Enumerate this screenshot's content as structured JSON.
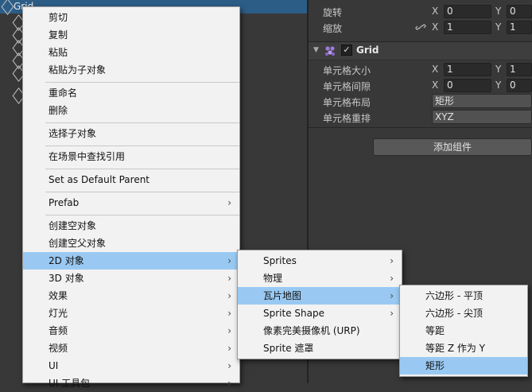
{
  "hierarchy": {
    "selected_item": "Grid"
  },
  "inspector": {
    "transform": {
      "rotation": {
        "label": "旋转",
        "x_axis": "X",
        "x": "0",
        "y_axis": "Y",
        "y": "0"
      },
      "scale": {
        "label": "缩放",
        "x_axis": "X",
        "x": "1",
        "y_axis": "Y",
        "y": "1"
      }
    },
    "grid_component": {
      "title": "Grid",
      "enabled_check": "✓",
      "cell_size": {
        "label": "单元格大小",
        "x_axis": "X",
        "x": "1",
        "y_axis": "Y",
        "y": "1"
      },
      "cell_gap": {
        "label": "单元格间隙",
        "x_axis": "X",
        "x": "0",
        "y_axis": "Y",
        "y": "0"
      },
      "cell_layout": {
        "label": "单元格布局",
        "value": "矩形"
      },
      "cell_swizzle": {
        "label": "单元格重排",
        "value": "XYZ"
      }
    },
    "add_component_label": "添加组件"
  },
  "context_menu": {
    "items": [
      {
        "label": "剪切"
      },
      {
        "label": "复制"
      },
      {
        "label": "粘贴"
      },
      {
        "label": "粘贴为子对象"
      },
      {
        "label": "重命名"
      },
      {
        "label": "删除"
      },
      {
        "label": "选择子对象"
      },
      {
        "label": "在场景中查找引用"
      },
      {
        "label": "Set as Default Parent"
      },
      {
        "label": "Prefab",
        "arrow": "›"
      },
      {
        "label": "创建空对象"
      },
      {
        "label": "创建空父对象"
      },
      {
        "label": "2D 对象",
        "arrow": "›"
      },
      {
        "label": "3D 对象",
        "arrow": "›"
      },
      {
        "label": "效果",
        "arrow": "›"
      },
      {
        "label": "灯光",
        "arrow": "›"
      },
      {
        "label": "音频",
        "arrow": "›"
      },
      {
        "label": "视频",
        "arrow": "›"
      },
      {
        "label": "UI",
        "arrow": "›"
      },
      {
        "label": "UI 工具包",
        "arrow": "›"
      }
    ]
  },
  "submenu_2d": {
    "items": [
      {
        "label": "Sprites",
        "arrow": "›"
      },
      {
        "label": "物理",
        "arrow": "›"
      },
      {
        "label": "瓦片地图",
        "arrow": "›"
      },
      {
        "label": "Sprite Shape",
        "arrow": "›"
      },
      {
        "label": "像素完美摄像机 (URP)"
      },
      {
        "label": "Sprite 遮罩"
      }
    ]
  },
  "submenu_tilemap": {
    "items": [
      {
        "label": "六边形 - 平顶"
      },
      {
        "label": "六边形 - 尖顶"
      },
      {
        "label": "等距"
      },
      {
        "label": "等距 Z 作为 Y"
      },
      {
        "label": "矩形"
      }
    ]
  },
  "colors": {
    "menu_highlight": "#99c9f2",
    "hierarchy_selection": "#2c5d87"
  }
}
